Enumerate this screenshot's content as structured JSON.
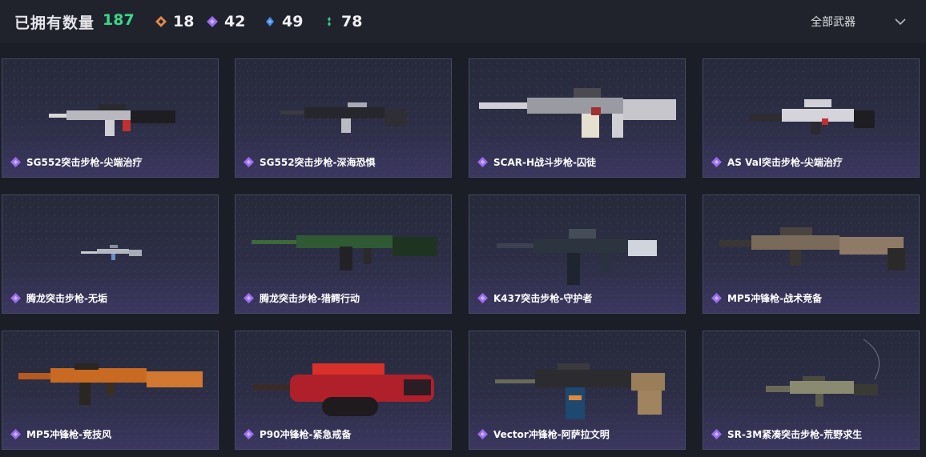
{
  "header": {
    "owned_label": "已拥有数量",
    "owned_count": "187",
    "stats": [
      {
        "icon": "orange-diamond-icon",
        "value": "18",
        "color": "#e08a4a"
      },
      {
        "icon": "purple-diamond-icon",
        "value": "42",
        "color": "#9b6cf0"
      },
      {
        "icon": "blue-diamond-icon",
        "value": "49",
        "color": "#4a8ee8"
      },
      {
        "icon": "green-diamond-icon",
        "value": "78",
        "color": "#35c88a"
      }
    ],
    "filter_label": "全部武器"
  },
  "cards": [
    {
      "name": "SG552突击步枪-尖端治疗"
    },
    {
      "name": "SG552突击步枪-深海恐惧"
    },
    {
      "name": "SCAR-H战斗步枪-囚徒"
    },
    {
      "name": "AS Val突击步枪-尖端治疗"
    },
    {
      "name": "腾龙突击步枪-无垢"
    },
    {
      "name": "腾龙突击步枪-猎鳄行动"
    },
    {
      "name": "K437突击步枪-守护者"
    },
    {
      "name": "MP5冲锋枪-战术竞备"
    },
    {
      "name": "MP5冲锋枪-竞技风"
    },
    {
      "name": "P90冲锋枪-紧急戒备"
    },
    {
      "name": "Vector冲锋枪-阿萨拉文明"
    },
    {
      "name": "SR-3M紧凑突击步枪-荒野求生"
    }
  ],
  "colors": {
    "accent_green": "#39d98a",
    "rank_purple": "#9b6cf0"
  }
}
